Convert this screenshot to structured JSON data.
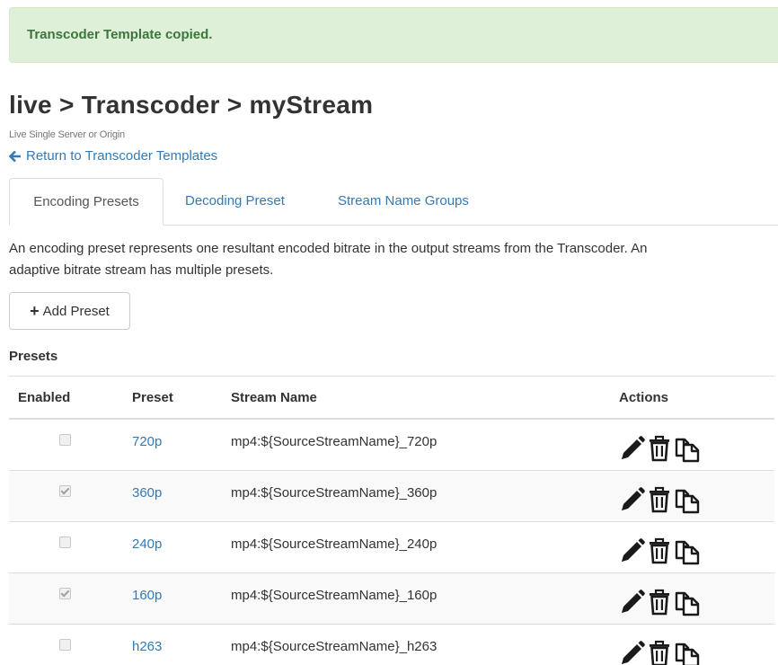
{
  "alert": {
    "message": "Transcoder Template copied.",
    "color": "#3c763d",
    "background": "#dff0d8"
  },
  "header": {
    "title": "live > Transcoder > myStream",
    "subtitle": "Live Single Server or Origin",
    "return_link": "Return to Transcoder Templates",
    "return_icon": "arrow-left-icon"
  },
  "tabs": [
    {
      "label": "Encoding Presets",
      "active": true
    },
    {
      "label": "Decoding Preset",
      "active": false
    },
    {
      "label": "Stream Name Groups",
      "active": false
    }
  ],
  "description": "An encoding preset represents one resultant encoded bitrate in the output streams from the Transcoder. An adaptive bitrate stream has multiple presets.",
  "add_button": {
    "label": "Add Preset",
    "icon": "plus-icon"
  },
  "presets": {
    "label": "Presets",
    "columns": [
      "Enabled",
      "Preset",
      "Stream Name",
      "Actions"
    ],
    "rows": [
      {
        "enabled": false,
        "preset": "720p",
        "stream_name": "mp4:${SourceStreamName}_720p"
      },
      {
        "enabled": true,
        "preset": "360p",
        "stream_name": "mp4:${SourceStreamName}_360p"
      },
      {
        "enabled": false,
        "preset": "240p",
        "stream_name": "mp4:${SourceStreamName}_240p"
      },
      {
        "enabled": true,
        "preset": "160p",
        "stream_name": "mp4:${SourceStreamName}_160p"
      },
      {
        "enabled": false,
        "preset": "h263",
        "stream_name": "mp4:${SourceStreamName}_h263"
      }
    ],
    "action_icons": [
      "pencil-icon",
      "trash-icon",
      "copy-icon"
    ]
  },
  "colors": {
    "link": "#337ab7",
    "text": "#333333",
    "border": "#dddddd",
    "stripe": "#f9f9f9"
  }
}
